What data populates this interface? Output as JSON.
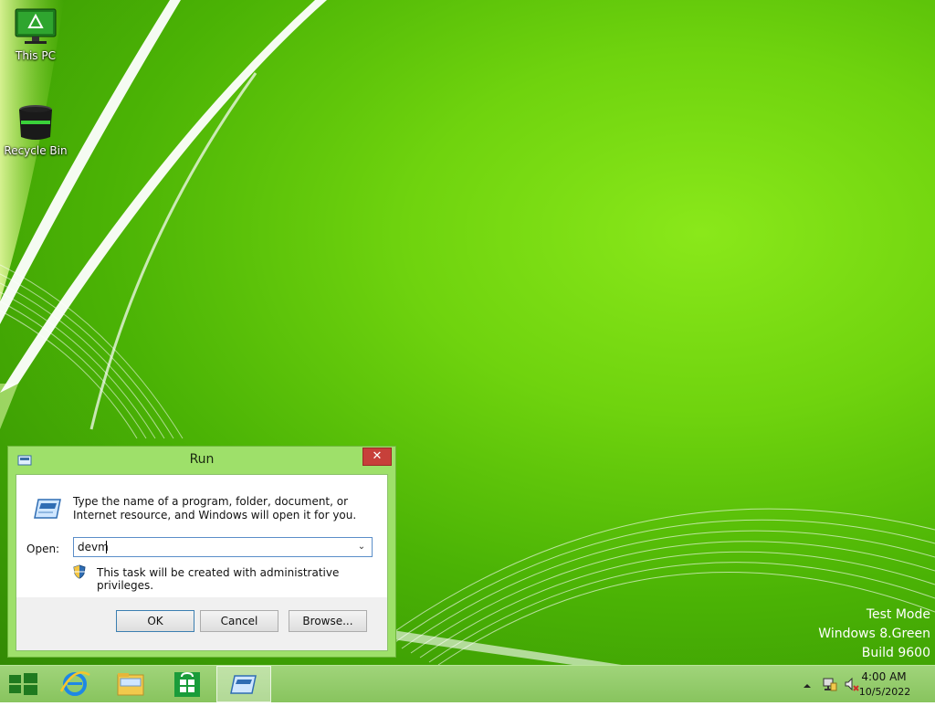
{
  "desktop": {
    "icons": [
      {
        "label": "This PC",
        "icon": "monitor-icon"
      },
      {
        "label": "Recycle Bin",
        "icon": "recycle-bin-icon"
      }
    ]
  },
  "run_dialog": {
    "title": "Run",
    "close_label": "✕",
    "description": "Type the name of a program, folder, document, or Internet resource, and Windows will open it for you.",
    "open_label": "Open:",
    "open_value": "devm",
    "dropdown_glyph": "⌄",
    "admin_note": "This task will be created with administrative privileges.",
    "buttons": {
      "ok": "OK",
      "cancel": "Cancel",
      "browse": "Browse..."
    }
  },
  "watermark": {
    "line1": "Test Mode",
    "line2": "Windows 8.Green",
    "line3": "Build 9600"
  },
  "taskbar": {
    "pinned": [
      "start-icon",
      "internet-explorer-icon",
      "file-explorer-icon",
      "store-icon",
      "run-icon"
    ],
    "tray": {
      "time": "4:00 AM",
      "date": "10/5/2022",
      "icons": [
        "show-hidden-icons-icon",
        "network-icon",
        "volume-muted-icon"
      ]
    }
  },
  "colors": {
    "accent": "#6fd30e",
    "taskbar": "#96cc6c",
    "close_button": "#c7403a"
  }
}
